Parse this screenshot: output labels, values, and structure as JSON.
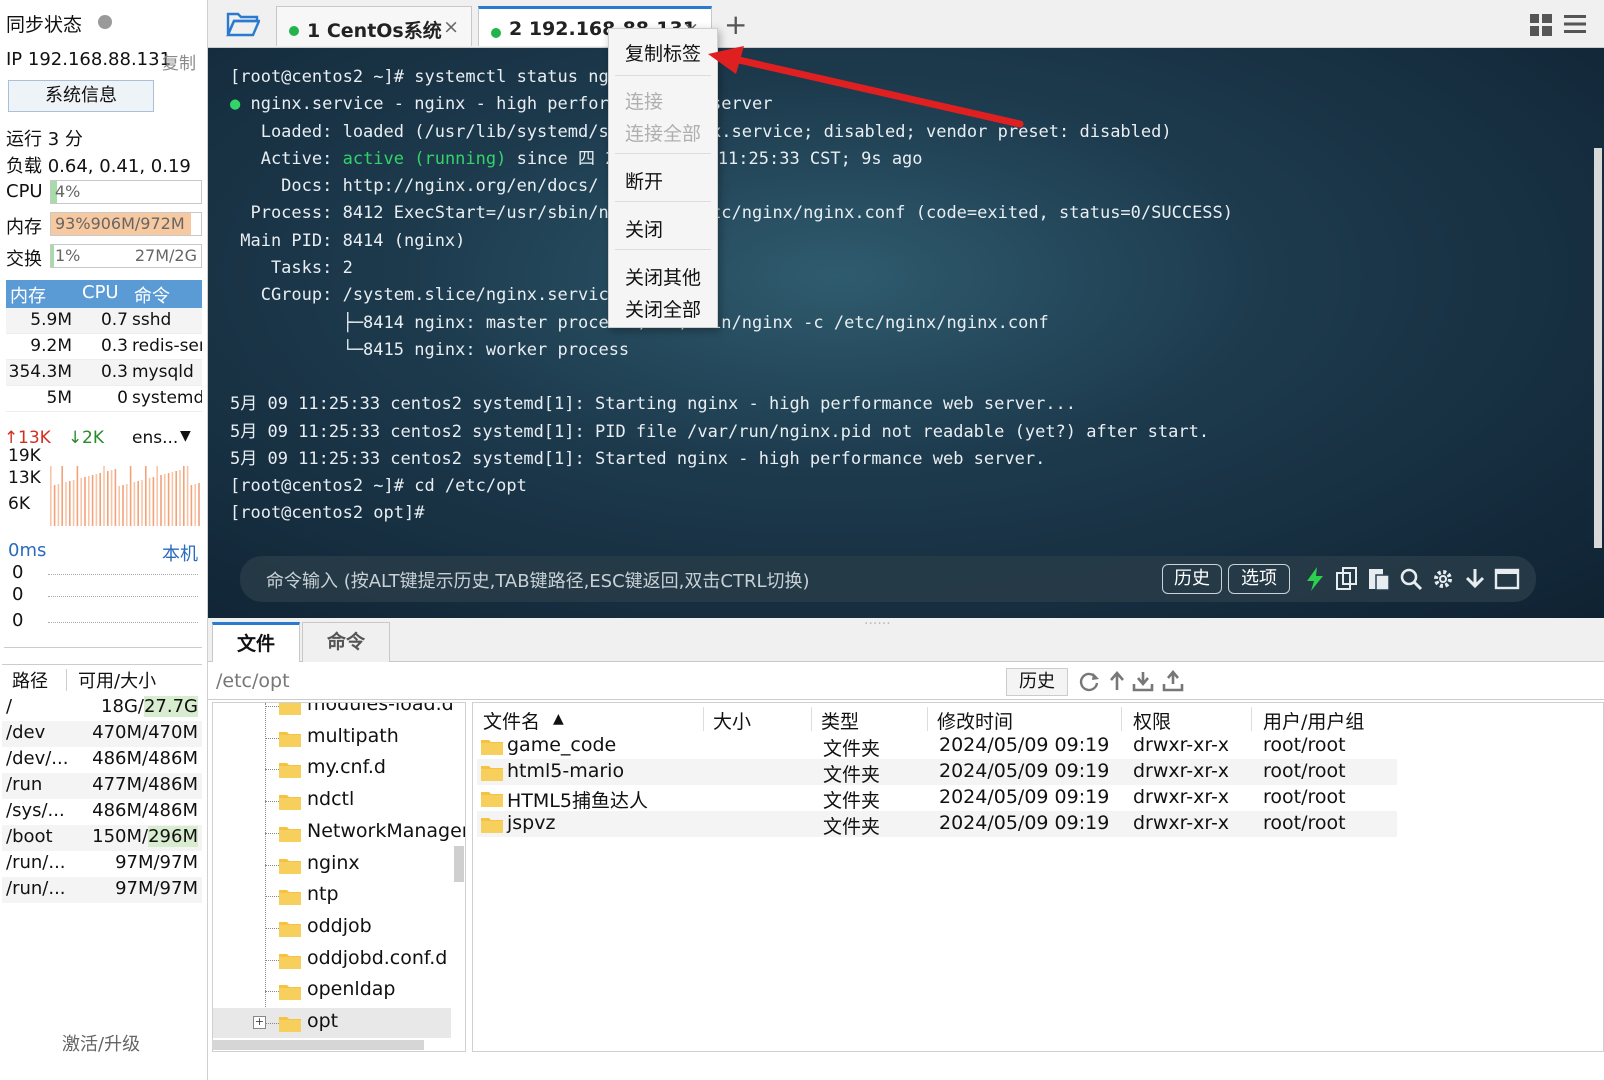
{
  "sidebar": {
    "sync_title": "同步状态",
    "ip_label": "IP 192.168.88.131",
    "ip_copy": "复制",
    "sysinfo_button": "系统信息",
    "uptime": "运行 3 分",
    "load": "负载 0.64, 0.41, 0.19",
    "cpu": {
      "label": "CPU",
      "text": "4%",
      "fill": 0.04,
      "color": "#c8e6c8"
    },
    "mem": {
      "label": "内存",
      "text": "93%906M/972M",
      "fill": 0.93,
      "color": "#f7c9a0"
    },
    "swap": {
      "label": "交换",
      "text": "1%",
      "text_right": "27M/2G",
      "fill": 0.01,
      "color": "#c8e6c8"
    },
    "proc_headers": [
      "内存",
      "CPU",
      "命令"
    ],
    "processes": [
      {
        "mem": "5.9M",
        "cpu": "0.7",
        "cmd": "sshd"
      },
      {
        "mem": "9.2M",
        "cpu": "0.3",
        "cmd": "redis-ser"
      },
      {
        "mem": "354.3M",
        "cpu": "0.3",
        "cmd": "mysqld"
      },
      {
        "mem": "5M",
        "cpu": "0",
        "cmd": "systemd"
      }
    ],
    "net": {
      "up": "13K",
      "down": "2K",
      "iface": "ens...",
      "ticks": [
        "19K",
        "13K",
        "6K"
      ]
    },
    "ping": {
      "latency": "0ms",
      "target": "本机",
      "values": [
        "0",
        "0",
        "0"
      ]
    },
    "disk_headers": [
      "路径",
      "可用/大小"
    ],
    "disks": [
      {
        "path": "/",
        "a": "18G/",
        "b": "27.7G"
      },
      {
        "path": "/dev",
        "a": "470M/470M",
        "b": ""
      },
      {
        "path": "/dev/...",
        "a": "486M/486M",
        "b": ""
      },
      {
        "path": "/run",
        "a": "477M/486M",
        "b": ""
      },
      {
        "path": "/sys/...",
        "a": "486M/486M",
        "b": ""
      },
      {
        "path": "/boot",
        "a": "150M/",
        "b": "296M"
      },
      {
        "path": "/run/...",
        "a": "97M/97M",
        "b": ""
      },
      {
        "path": "/run/...",
        "a": "97M/97M",
        "b": ""
      }
    ],
    "activate": "激活/升级"
  },
  "tabs": [
    {
      "label": "1 CentOs系统",
      "close": "×"
    },
    {
      "label": "2 192.168.88.131",
      "close": "×"
    }
  ],
  "tab_plus": "+",
  "terminal": {
    "line1": "[root@centos2 ~]# systemctl status nginx",
    "line2a": "● ",
    "line2b": "nginx.service - nginx - high performance web server",
    "line3": "   Loaded: loaded (/usr/lib/systemd/system/nginx.service; disabled; vendor preset: disabled)",
    "line4a": "   Active: ",
    "line4b": "active (running)",
    "line4c": " since 四 2024-05-09 11:25:33 CST; 9s ago",
    "line5": "     Docs: http://nginx.org/en/docs/",
    "line6": "  Process: 8412 ExecStart=/usr/sbin/nginx -c /etc/nginx/nginx.conf (code=exited, status=0/SUCCESS)",
    "line7": " Main PID: 8414 (nginx)",
    "line8": "    Tasks: 2",
    "line9": "   CGroup: /system.slice/nginx.service",
    "line10": "           ├─8414 nginx: master process /usr/sbin/nginx -c /etc/nginx/nginx.conf",
    "line11": "           └─8415 nginx: worker process",
    "line12": "",
    "line13": "5月 09 11:25:33 centos2 systemd[1]: Starting nginx - high performance web server...",
    "line14": "5月 09 11:25:33 centos2 systemd[1]: PID file /var/run/nginx.pid not readable (yet?) after start.",
    "line15": "5月 09 11:25:33 centos2 systemd[1]: Started nginx - high performance web server.",
    "line16": "[root@centos2 ~]# cd /etc/opt",
    "line17": "[root@centos2 opt]#"
  },
  "cmd_bar": {
    "placeholder": "命令输入 (按ALT键提示历史,TAB键路径,ESC键返回,双击CTRL切换)",
    "history": "历史",
    "options": "选项"
  },
  "context_menu": {
    "copy_tag": "复制标签",
    "connect": "连接",
    "connect_all": "连接全部",
    "disconnect": "断开",
    "close": "关闭",
    "close_others": "关闭其他",
    "close_all": "关闭全部"
  },
  "bottom_tabs": [
    "文件",
    "命令"
  ],
  "path": {
    "value": "/etc/opt",
    "history": "历史"
  },
  "tree": [
    "modules-load.d",
    "multipath",
    "my.cnf.d",
    "ndctl",
    "NetworkManager",
    "nginx",
    "ntp",
    "oddjob",
    "oddjobd.conf.d",
    "openldap",
    "opt"
  ],
  "file_headers": {
    "name": "文件名",
    "size": "大小",
    "type": "类型",
    "mtime": "修改时间",
    "perm": "权限",
    "owner": "用户/用户组"
  },
  "files": [
    {
      "name": "game_code",
      "type": "文件夹",
      "mtime": "2024/05/09 09:19",
      "perm": "drwxr-xr-x",
      "owner": "root/root"
    },
    {
      "name": "html5-mario",
      "type": "文件夹",
      "mtime": "2024/05/09 09:19",
      "perm": "drwxr-xr-x",
      "owner": "root/root"
    },
    {
      "name": "HTML5捕鱼达人",
      "type": "文件夹",
      "mtime": "2024/05/09 09:19",
      "perm": "drwxr-xr-x",
      "owner": "root/root"
    },
    {
      "name": "jspvz",
      "type": "文件夹",
      "mtime": "2024/05/09 09:19",
      "perm": "drwxr-xr-x",
      "owner": "root/root"
    }
  ],
  "colors": {
    "accent": "#5b9bd5",
    "terminal_green": "#33d36a",
    "folder": "#f5c243",
    "arrow": "#e02020"
  }
}
